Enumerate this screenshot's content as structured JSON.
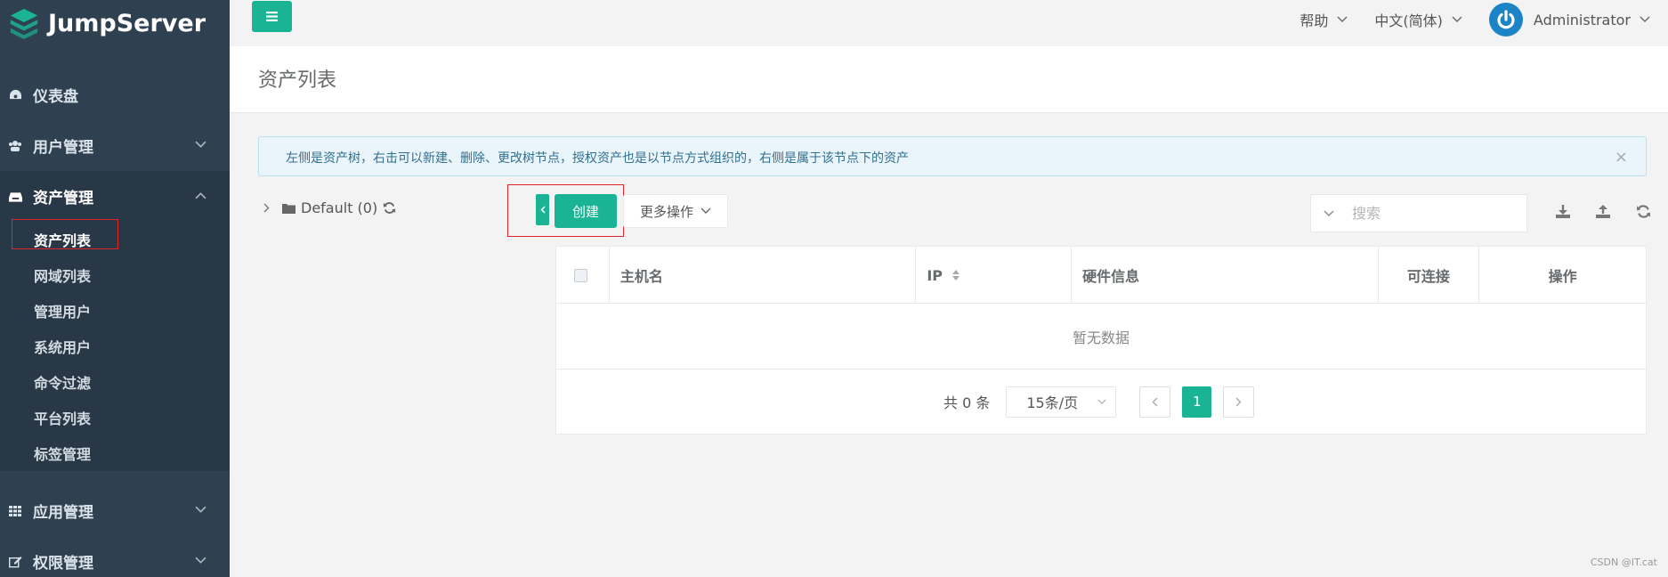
{
  "brand": {
    "name": "JumpServer",
    "logo_icon": "jumpserver-logo-icon"
  },
  "sidebar": {
    "items": [
      {
        "label": "仪表盘",
        "icon": "dashboard-icon"
      },
      {
        "label": "用户管理",
        "icon": "users-icon"
      },
      {
        "label": "资产管理",
        "icon": "inbox-icon",
        "expanded": true,
        "children": [
          "资产列表",
          "网域列表",
          "管理用户",
          "系统用户",
          "命令过滤",
          "平台列表",
          "标签管理"
        ]
      },
      {
        "label": "应用管理",
        "icon": "grid-icon"
      },
      {
        "label": "权限管理",
        "icon": "edit-icon"
      }
    ],
    "active_child": "资产列表"
  },
  "topbar": {
    "help": "帮助",
    "language": "中文(简体)",
    "user": "Administrator"
  },
  "page": {
    "title": "资产列表",
    "alert": "左侧是资产树，右击可以新建、删除、更改树节点，授权资产也是以节点方式组织的，右侧是属于该节点下的资产",
    "tree_root": "Default (0)"
  },
  "toolbar": {
    "create_label": "创建",
    "more_label": "更多操作",
    "search_placeholder": "搜索"
  },
  "table": {
    "columns": [
      "主机名",
      "IP",
      "硬件信息",
      "可连接",
      "操作"
    ],
    "empty_text": "暂无数据"
  },
  "pagination": {
    "total_text": "共 0 条",
    "page_size": "15条/页",
    "current_page": "1"
  },
  "colors": {
    "accent": "#1ab394",
    "sidebar": "#2f4050",
    "highlight_border": "#e0252b"
  },
  "watermark": "CSDN @IT.cat"
}
